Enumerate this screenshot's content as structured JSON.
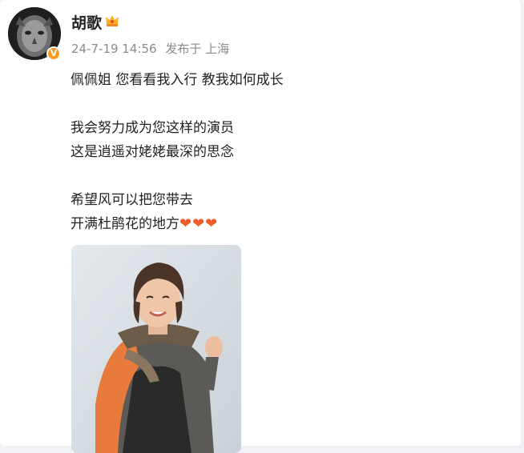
{
  "post": {
    "author": "胡歌",
    "time": "24-7-19 14:56",
    "source": "发布于 上海",
    "lines": [
      "佩佩姐 您看看我入行 教我如何成长",
      "我会努力成为您这样的演员",
      "这是逍遥对姥姥最深的思念",
      "希望风可以把您带去",
      "开满杜鹃花的地方"
    ],
    "hearts": "❤❤❤",
    "colors": {
      "heart": "#f25c2b",
      "verified": "#f79a1d",
      "meta": "#8b8b8b"
    },
    "icons": [
      "avatar-image",
      "verified-badge-icon",
      "crown-icon",
      "heart-icon"
    ]
  }
}
